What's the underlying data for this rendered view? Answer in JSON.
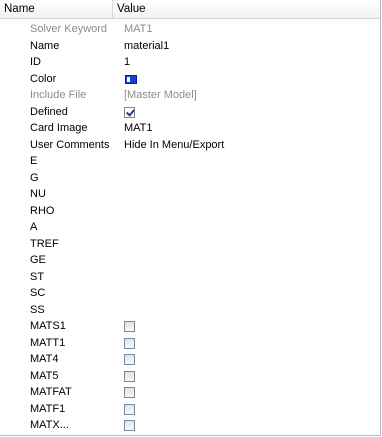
{
  "header": {
    "name_label": "Name",
    "value_label": "Value"
  },
  "rows": [
    {
      "name": "Solver Keyword",
      "value": "MAT1",
      "type": "text",
      "dim": true
    },
    {
      "name": "Name",
      "value": "material1",
      "type": "text",
      "dim": false
    },
    {
      "name": "ID",
      "value": "1",
      "type": "text",
      "dim": false
    },
    {
      "name": "Color",
      "value": "",
      "type": "color",
      "dim": false,
      "color_hex": "#1a3fd6"
    },
    {
      "name": "Include File",
      "value": "[Master Model]",
      "type": "text",
      "dim": true
    },
    {
      "name": "Defined",
      "value": "",
      "type": "checkbox",
      "checked": true,
      "dim": false
    },
    {
      "name": "Card Image",
      "value": "MAT1",
      "type": "text",
      "dim": false
    },
    {
      "name": "User Comments",
      "value": "Hide In Menu/Export",
      "type": "text",
      "dim": false
    },
    {
      "name": "E",
      "value": "",
      "type": "text",
      "dim": false
    },
    {
      "name": "G",
      "value": "",
      "type": "text",
      "dim": false
    },
    {
      "name": "NU",
      "value": "",
      "type": "text",
      "dim": false
    },
    {
      "name": "RHO",
      "value": "",
      "type": "text",
      "dim": false
    },
    {
      "name": "A",
      "value": "",
      "type": "text",
      "dim": false
    },
    {
      "name": "TREF",
      "value": "",
      "type": "text",
      "dim": false
    },
    {
      "name": "GE",
      "value": "",
      "type": "text",
      "dim": false
    },
    {
      "name": "ST",
      "value": "",
      "type": "text",
      "dim": false
    },
    {
      "name": "SC",
      "value": "",
      "type": "text",
      "dim": false
    },
    {
      "name": "SS",
      "value": "",
      "type": "text",
      "dim": false
    },
    {
      "name": "MATS1",
      "value": "",
      "type": "checkbox",
      "checked": false,
      "dim": false
    },
    {
      "name": "MATT1",
      "value": "",
      "type": "checkbox",
      "checked": false,
      "dim": false
    },
    {
      "name": "MAT4",
      "value": "",
      "type": "checkbox",
      "checked": false,
      "dim": false
    },
    {
      "name": "MAT5",
      "value": "",
      "type": "checkbox",
      "checked": false,
      "dim": false
    },
    {
      "name": "MATFAT",
      "value": "",
      "type": "checkbox",
      "checked": false,
      "dim": false
    },
    {
      "name": "MATF1",
      "value": "",
      "type": "checkbox",
      "checked": false,
      "dim": false
    },
    {
      "name": "MATX...",
      "value": "",
      "type": "checkbox",
      "checked": false,
      "dim": false
    }
  ]
}
